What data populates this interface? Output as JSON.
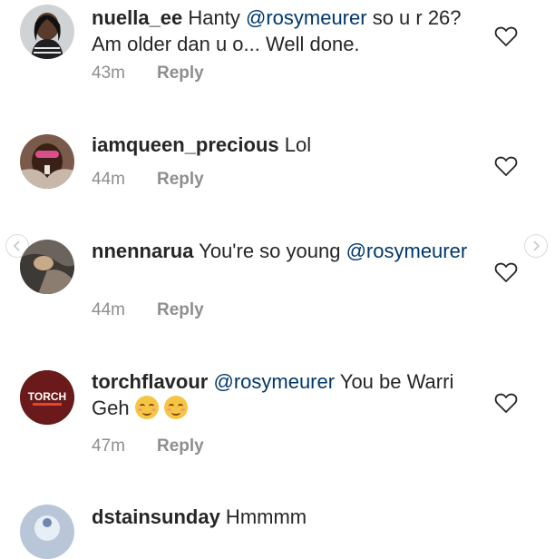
{
  "comments": [
    {
      "username": "nuella_ee",
      "text_before": " Hanty ",
      "mention": "@rosymeurer",
      "text_after": " so u r 26? Am older dan u o... Well done.",
      "time": "43m",
      "reply_label": "Reply"
    },
    {
      "username": "iamqueen_precious",
      "text_before": " Lol",
      "mention": "",
      "text_after": "",
      "time": "44m",
      "reply_label": "Reply"
    },
    {
      "username": "nnennarua",
      "text_before": " You're so young ",
      "mention": "@rosymeurer",
      "text_after": "",
      "time": "44m",
      "reply_label": "Reply"
    },
    {
      "username": "torchflavour",
      "text_before": " ",
      "mention": "@rosymeurer",
      "text_after": " You be Warri Geh",
      "emoji_count": 2,
      "time": "47m",
      "reply_label": "Reply",
      "avatar_logo_text": "TORCH"
    },
    {
      "username": "dstainsunday",
      "text_before": " Hmmmm",
      "mention": "",
      "text_after": ""
    }
  ],
  "icons": {
    "like": "heart-outline-icon",
    "prev": "chevron-left-icon",
    "next": "chevron-right-icon"
  },
  "colors": {
    "text": "#262626",
    "mention": "#00376b",
    "secondary": "#8e8e8e"
  }
}
